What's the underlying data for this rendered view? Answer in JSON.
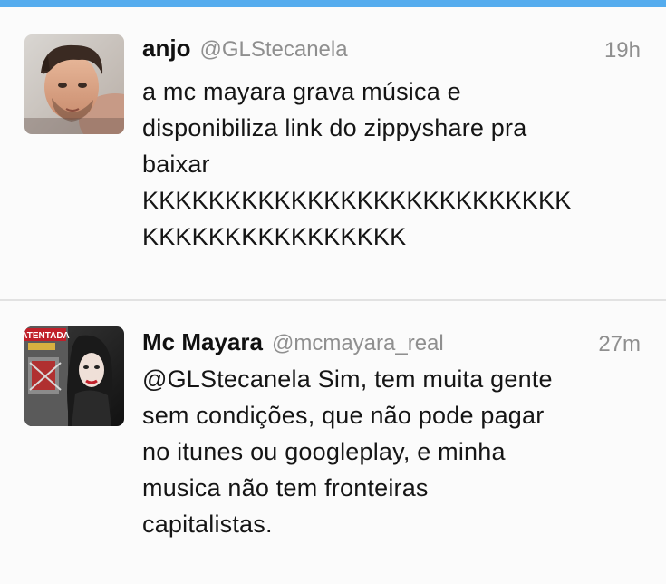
{
  "app": {
    "accent_color": "#55acee",
    "background_color": "#fbfbfb",
    "divider_color": "#e2e2e2"
  },
  "tweets": [
    {
      "avatar": "avatar-young-man-photo",
      "name": "anjo",
      "handle": "@GLStecanela",
      "time": "19h",
      "text_lines": [
        "a mc mayara grava música e",
        "disponibiliza link do zippyshare pra",
        "baixar",
        "KKKKKKKKKKKKKKKKKKKKKKKKKK",
        "KKKKKKKKKKKKKKKK"
      ]
    },
    {
      "avatar": "avatar-album-cover-woman",
      "avatar_cover_text": "ATENTADA",
      "name": "Mc Mayara",
      "handle": "@mcmayara_real",
      "time": "27m",
      "text_lines": [
        "@GLStecanela Sim, tem muita gente",
        "sem condições, que não pode pagar",
        "no itunes ou googleplay, e minha",
        "musica não tem fronteiras",
        "capitalistas."
      ]
    }
  ]
}
